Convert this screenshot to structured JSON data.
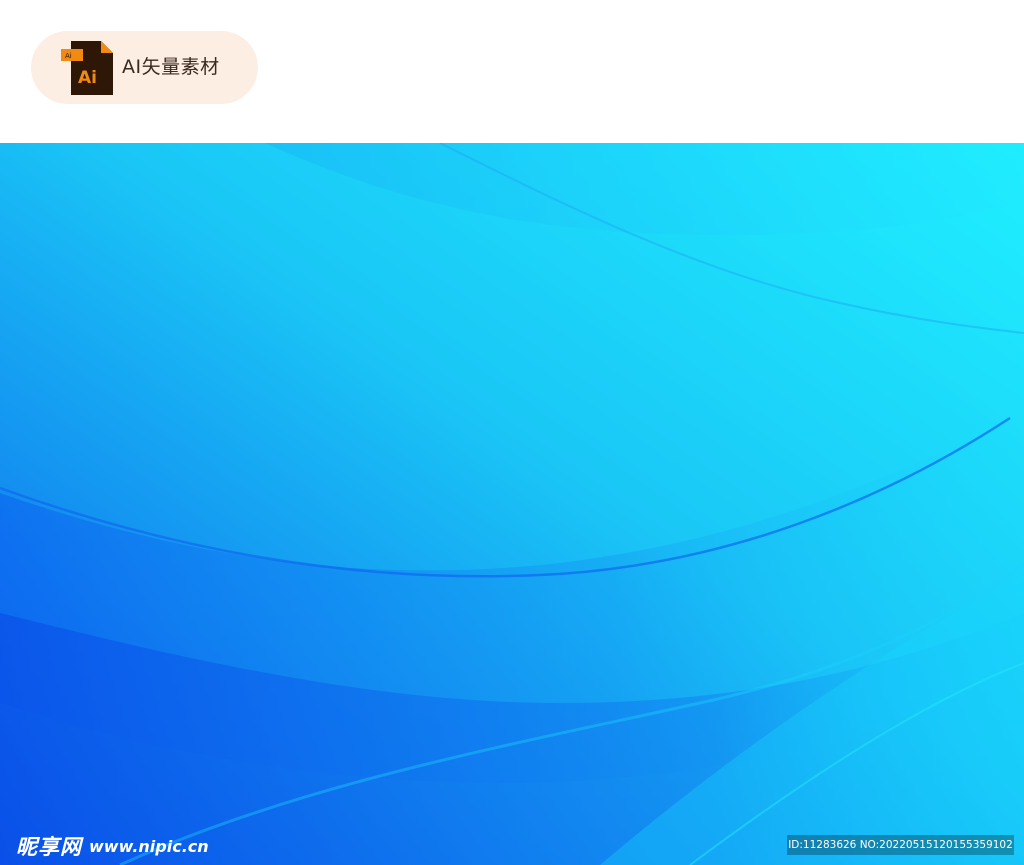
{
  "badge": {
    "icon": "adobe-illustrator-file-icon",
    "icon_text_large": "Ai",
    "icon_text_small": "Ai",
    "label": "AI矢量素材",
    "pill_color": "#fdeee3"
  },
  "artwork": {
    "description_colors": {
      "top_right": "#1ee8ff",
      "middle": "#19c3f5",
      "bottom_left": "#0a55ee"
    }
  },
  "watermark": {
    "site_name": "昵享网",
    "site_url": "www.nipic.cn",
    "id_text": "ID:11283626 NO:20220515120155359102"
  }
}
